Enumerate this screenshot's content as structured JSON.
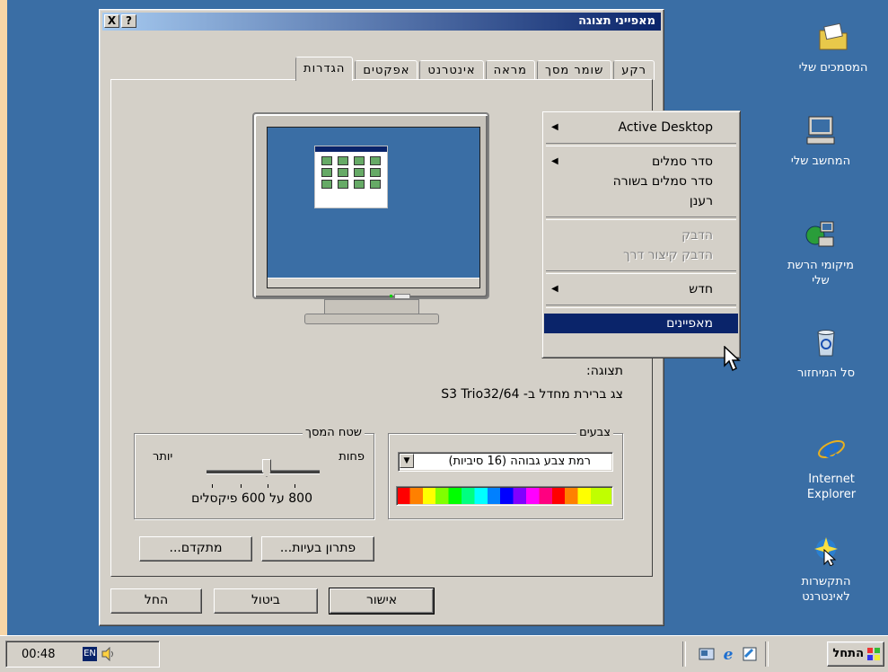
{
  "window": {
    "title": "מאפייני תצוגה",
    "help_btn": "?",
    "close_btn": "X"
  },
  "tabs": [
    "רקע",
    "שומר מסך",
    "מראה",
    "אינטרנט",
    "אפקטים",
    "הגדרות"
  ],
  "active_tab": "הגדרות",
  "display": {
    "label": "תצוגה:",
    "adapter": "צג ברירת מחדל ב- S3 Trio32/64"
  },
  "colors": {
    "legend": "צבעים",
    "selected": "רמת צבע גבוהה (16 סיביות)"
  },
  "screen_area": {
    "legend": "שטח המסך",
    "less": "פחות",
    "more": "יותר",
    "resolution": "800 על 600 פיקסלים"
  },
  "buttons": {
    "troubleshoot": "פתרון בעיות...",
    "advanced": "מתקדם...",
    "ok": "אישור",
    "cancel": "ביטול",
    "apply": "החל"
  },
  "context_menu": {
    "items": [
      {
        "label": "Active Desktop",
        "submenu": true,
        "disabled": false
      },
      {
        "label": "סדר סמלים",
        "submenu": true,
        "disabled": false
      },
      {
        "label": "סדר סמלים בשורה",
        "submenu": false,
        "disabled": false
      },
      {
        "label": "רענן",
        "submenu": false,
        "disabled": false
      },
      {
        "label": "הדבק",
        "submenu": false,
        "disabled": true
      },
      {
        "label": "הדבק קיצור דרך",
        "submenu": false,
        "disabled": true
      },
      {
        "label": "חדש",
        "submenu": true,
        "disabled": false
      },
      {
        "label": "מאפיינים",
        "submenu": false,
        "disabled": false,
        "highlighted": true
      }
    ]
  },
  "desktop_icons": [
    {
      "label": "המסמכים שלי",
      "icon": "folder-documents-icon"
    },
    {
      "label": "המחשב שלי",
      "icon": "computer-icon"
    },
    {
      "label": "מיקומי הרשת שלי",
      "icon": "network-icon"
    },
    {
      "label": "סל המיחזור",
      "icon": "recycle-bin-icon"
    },
    {
      "label": "Internet Explorer",
      "icon": "internet-explorer-icon"
    },
    {
      "label": "התקשרות לאינטרנט",
      "icon": "connect-internet-icon"
    }
  ],
  "taskbar": {
    "start": "התחל",
    "time": "00:48",
    "lang": "EN"
  },
  "theme": {
    "desktop": "#3a6ea5",
    "titlebar": "#0a246a",
    "face": "#d4d0c8"
  }
}
